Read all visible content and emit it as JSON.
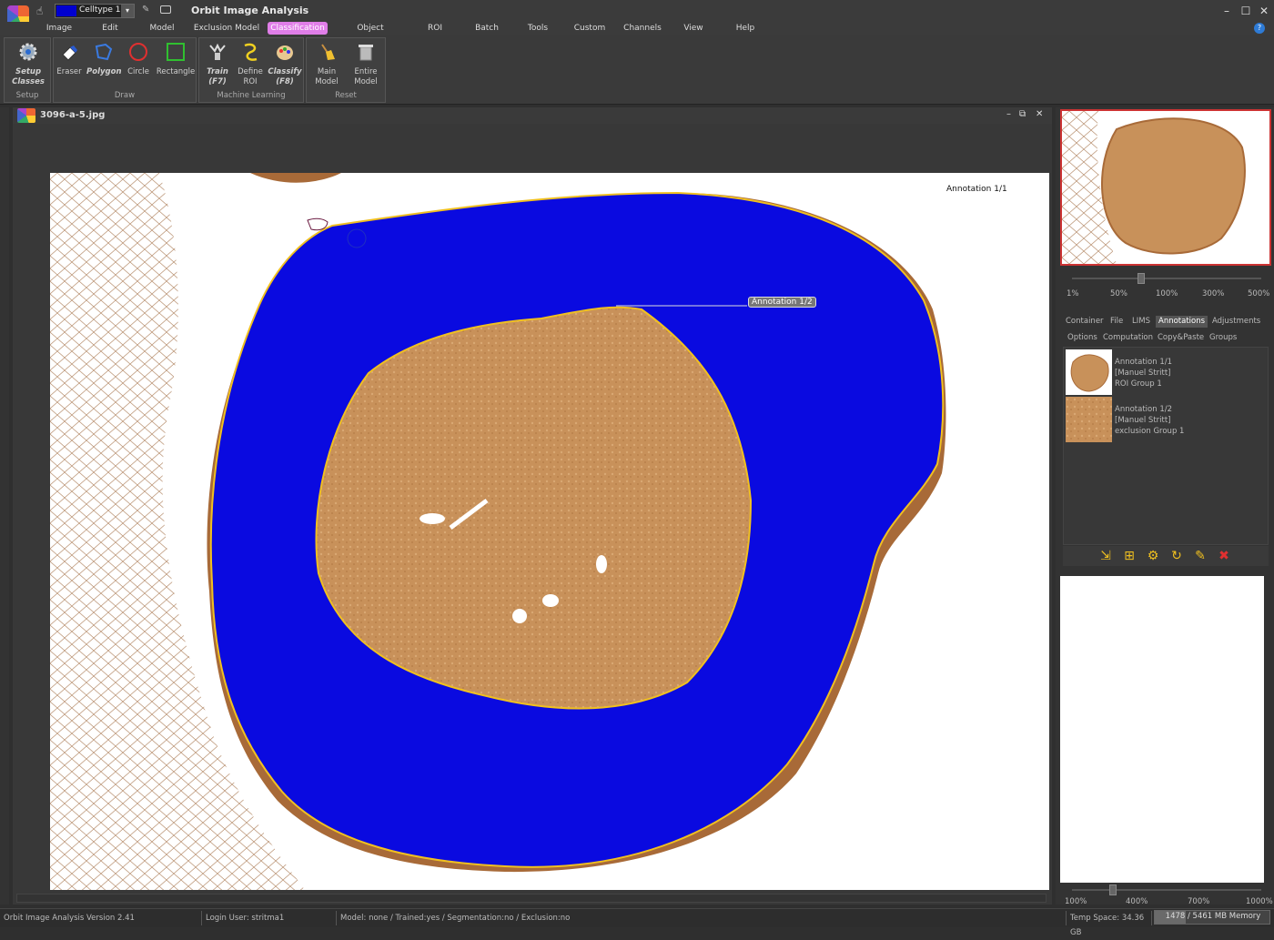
{
  "app": {
    "title": "Orbit Image Analysis",
    "celltype": "Celltype 1",
    "celltype_color": "#0000d0"
  },
  "menu": [
    "Image",
    "Edit",
    "Model",
    "Exclusion Model",
    "Classification",
    "Object Detection",
    "ROI",
    "Batch",
    "Tools",
    "Custom",
    "Channels",
    "View",
    "Help"
  ],
  "menu_active": "Classification",
  "ribbon": {
    "setup": {
      "group": "Setup",
      "setup_classes": "Setup\nClasses"
    },
    "draw": {
      "group": "Draw",
      "eraser": "Eraser",
      "polygon": "Polygon",
      "circle": "Circle",
      "rectangle": "Rectangle"
    },
    "ml": {
      "group": "Machine Learning",
      "train": "Train\n(F7)",
      "define_roi": "Define\nROI",
      "classify": "Classify\n(F8)"
    },
    "reset": {
      "group": "Reset",
      "main_model": "Main\nModel",
      "entire_model": "Entire\nModel"
    }
  },
  "document": {
    "title": "3096-a-5.jpg",
    "annotation_label_1": "Annotation 1/1",
    "annotation_label_2": "Annotation 1/2"
  },
  "right_panel": {
    "zoom_ticks": [
      "1%",
      "50%",
      "100%",
      "300%",
      "500%"
    ],
    "tabs": [
      "Container",
      "File",
      "LIMS",
      "Annotations",
      "Adjustments"
    ],
    "active_tab": "Annotations",
    "subtabs": [
      "Options",
      "Computation",
      "Copy&Paste",
      "Groups"
    ],
    "annotations": [
      {
        "name": "Annotation 1/1",
        "user": "[Manuel Stritt]",
        "group": "ROI Group 1"
      },
      {
        "name": "Annotation 1/2",
        "user": "[Manuel Stritt]",
        "group": "exclusion Group 1"
      }
    ],
    "zoom2_ticks": [
      "100%",
      "400%",
      "700%",
      "1000%"
    ]
  },
  "status": {
    "version": "Orbit Image Analysis Version 2.41",
    "login": "Login User: stritma1",
    "model": "Model: none / Trained:yes / Segmentation:no / Exclusion:no",
    "temp_space": "Temp Space: 34.36 GB",
    "memory": "1478 / 5461 MB Memory",
    "memory_fraction": 0.27
  },
  "colors": {
    "roi_fill": "#0000e0",
    "roi_border": "#f0c020",
    "tissue": "#c8915a",
    "active_menu": "#e07ee8"
  }
}
